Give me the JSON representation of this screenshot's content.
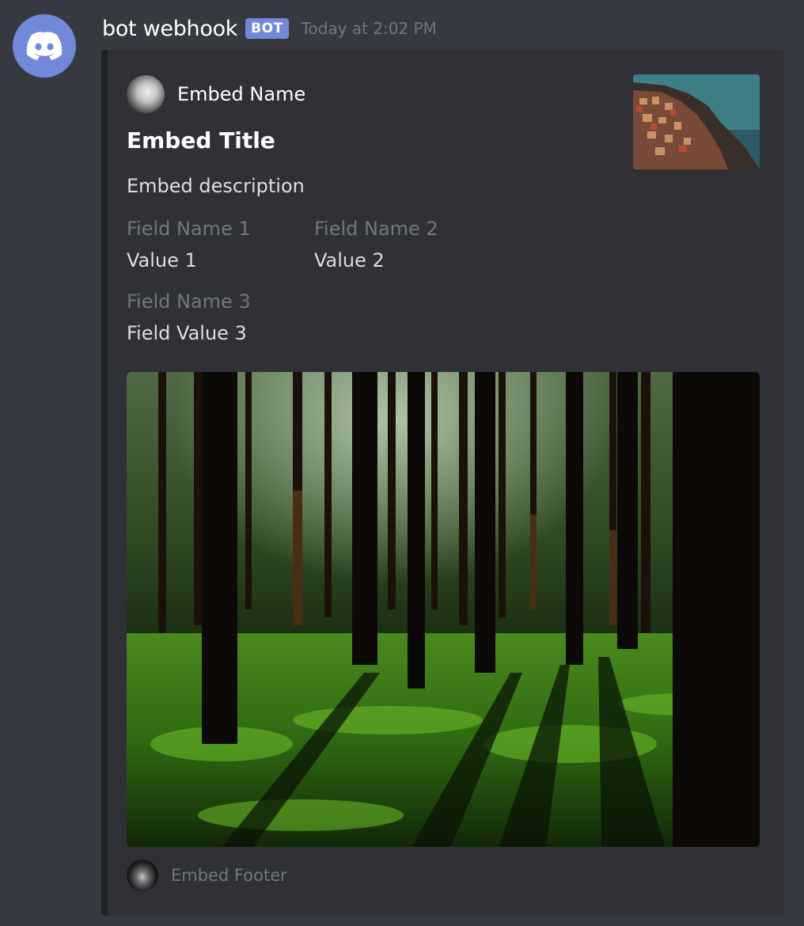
{
  "message": {
    "username": "bot webhook",
    "bot_tag": "BOT",
    "timestamp": "Today at 2:02 PM",
    "avatar_icon": "discord-logo-icon"
  },
  "embed": {
    "author_name": "Embed Name",
    "title": "Embed Title",
    "description": "Embed description",
    "fields": [
      {
        "name": "Field Name 1",
        "value": "Value 1"
      },
      {
        "name": "Field Name 2",
        "value": "Value 2"
      },
      {
        "name": "Field Name 3",
        "value": "Field Value 3"
      }
    ],
    "footer_text": "Embed Footer"
  },
  "colors": {
    "background": "#36393f",
    "embed_background": "#2f3136",
    "blurple": "#7289da",
    "muted_text": "#72767d"
  }
}
